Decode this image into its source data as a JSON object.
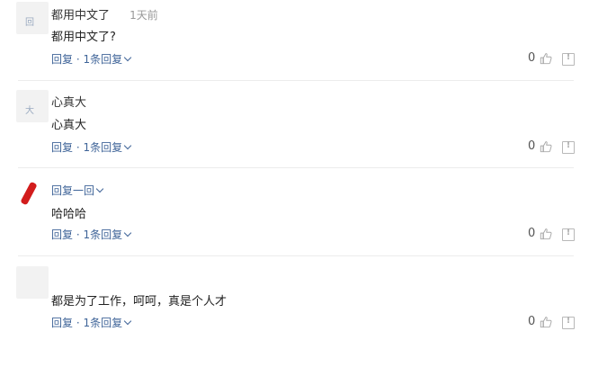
{
  "comments": [
    {
      "username": "都用中文了",
      "time": "1天前",
      "content": "都用中文了?",
      "reply_label": "回复 · 1条回复",
      "likes": "0"
    },
    {
      "username": "心真大",
      "time": "",
      "content": "心真大",
      "reply_label": "回复 · 1条回复",
      "likes": "0"
    },
    {
      "username": "回复一回",
      "time": "",
      "content": "哈哈哈",
      "reply_label": "回复 · 1条回复",
      "likes": "0"
    },
    {
      "username": "",
      "time": "",
      "content": "都是为了工作，呵呵，真是个人才",
      "reply_label": "回复 · 1条回复",
      "likes": "0"
    }
  ],
  "icons": {
    "like": "thumbs-up-icon",
    "report": "report-icon",
    "expand": "chevron-down-icon"
  },
  "colors": {
    "link": "#406599",
    "muted": "#999999",
    "accent_red": "#d21c1c"
  }
}
